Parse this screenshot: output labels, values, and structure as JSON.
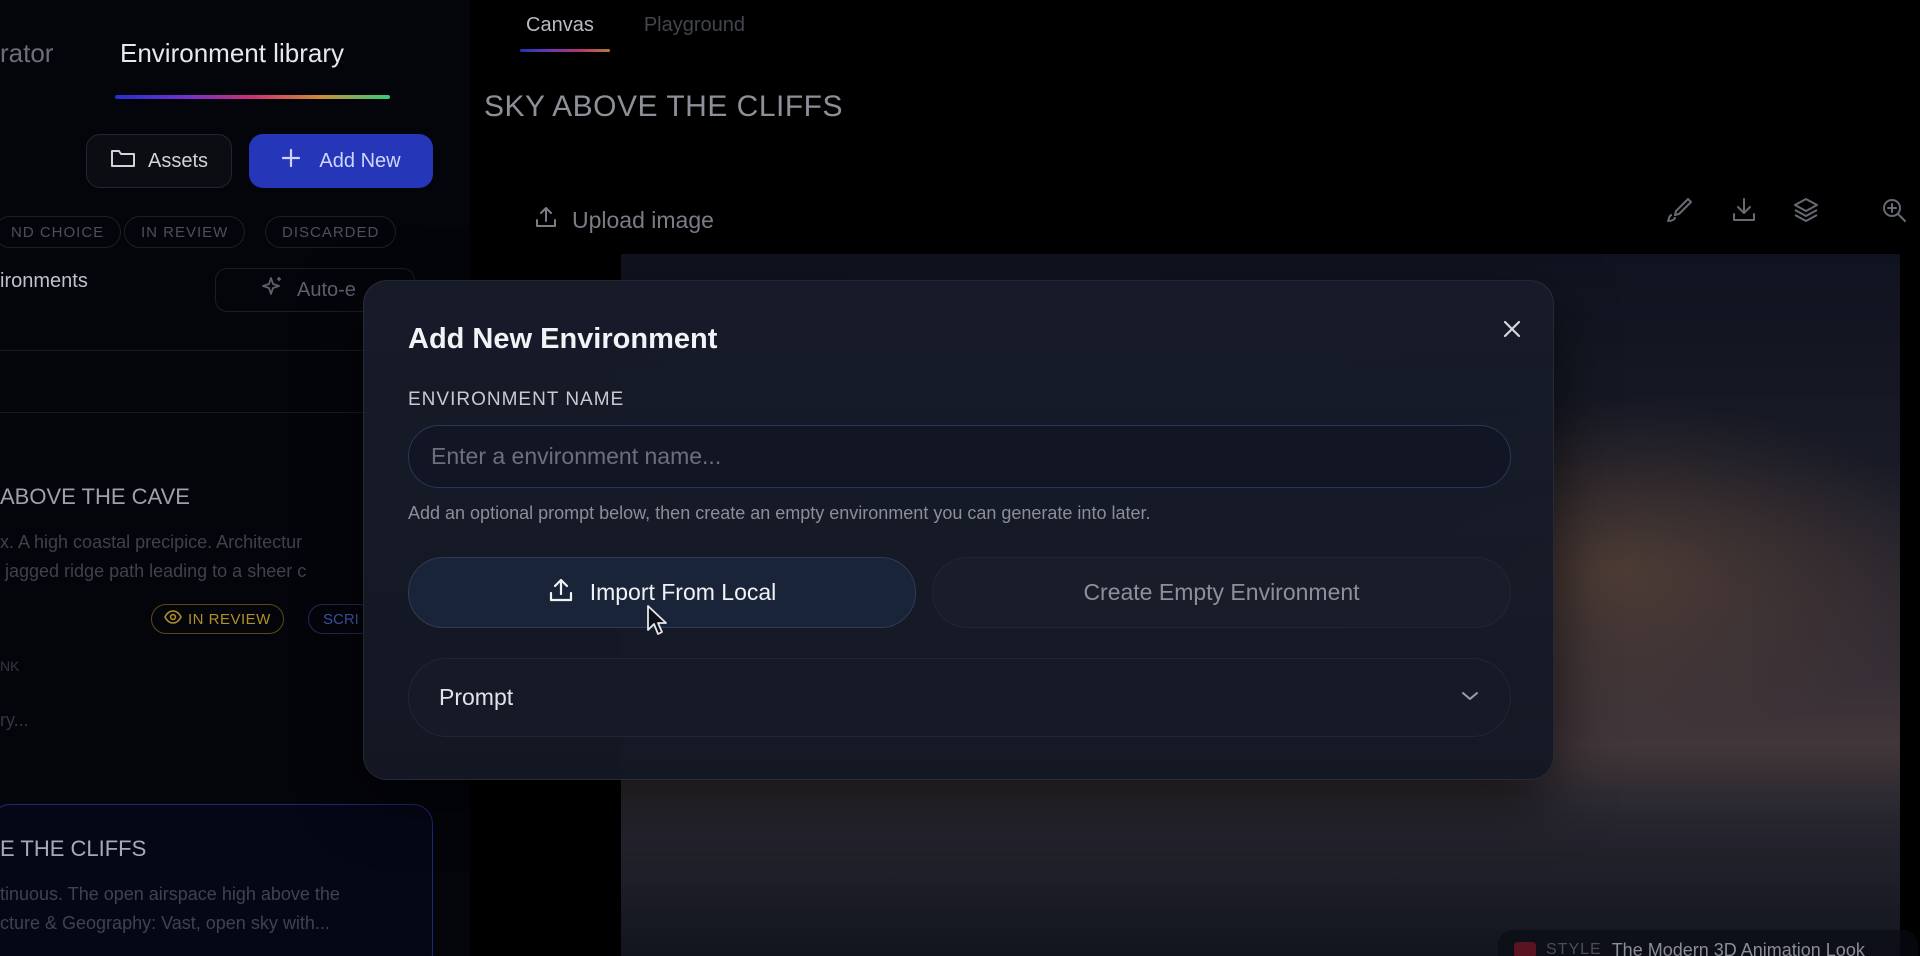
{
  "sidebar": {
    "tab_partial": "rator",
    "tab_active": "Environment library",
    "assets_label": "Assets",
    "add_new_label": "Add New",
    "filters": [
      "ND CHOICE",
      "IN REVIEW",
      "DISCARDED"
    ],
    "environments_label": "ironments",
    "auto_label": "Auto-e",
    "card1": {
      "title": "ABOVE THE CAVE",
      "desc": "x. A high coastal precipice. Architectur\n jagged ridge path leading to a sheer c",
      "badge_review": "IN REVIEW",
      "badge_script": "SCRI",
      "meta1": "NK",
      "meta2": "ry..."
    },
    "card2": {
      "title": "E THE CLIFFS",
      "desc": "tinuous. The open airspace high above the\ncture & Geography: Vast, open sky with..."
    }
  },
  "main": {
    "tabs": [
      {
        "label": "Canvas",
        "active": true
      },
      {
        "label": "Playground",
        "active": false
      }
    ],
    "title": "SKY ABOVE THE CLIFFS",
    "upload_label": "Upload image",
    "style_label": "STYLE",
    "style_value": "The Modern 3D Animation Look"
  },
  "modal": {
    "title": "Add New Environment",
    "field_label": "ENVIRONMENT NAME",
    "name_placeholder": "Enter a environment name...",
    "name_value": "",
    "hint": "Add an optional prompt below, then create an empty environment you can generate into later.",
    "import_label": "Import From Local",
    "create_empty_label": "Create Empty Environment",
    "prompt_label": "Prompt"
  },
  "colors": {
    "accent": "#2636b8",
    "modal_bg": "#181c2a",
    "review_badge": "#b08f2a"
  },
  "icons": [
    "folder-icon",
    "plus-icon",
    "sparkle-icon",
    "eye-icon",
    "upload-icon",
    "brush-icon",
    "download-icon",
    "layers-icon",
    "zoom-in-icon",
    "close-icon",
    "chevron-down-icon"
  ]
}
